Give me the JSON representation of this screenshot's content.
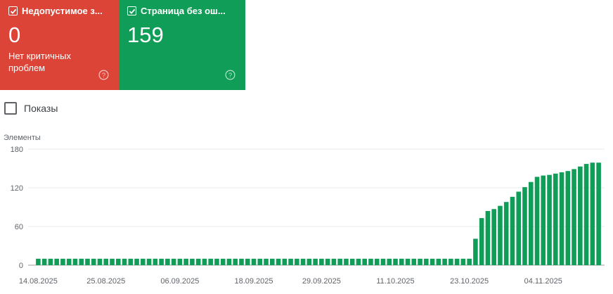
{
  "cards": [
    {
      "title": "Недопустимое з...",
      "value": "0",
      "description": "Нет критичных проблем",
      "color": "#db4437",
      "checked": true
    },
    {
      "title": "Страница без ош...",
      "value": "159",
      "description": "",
      "color": "#0f9d58",
      "checked": true
    }
  ],
  "impressions": {
    "label": "Показы",
    "checked": false
  },
  "chart_data": {
    "type": "bar",
    "ylabel": "Элементы",
    "ylim": [
      0,
      180
    ],
    "yticks": [
      0,
      60,
      120,
      180
    ],
    "x_tick_labels": [
      "14.08.2025",
      "25.08.2025",
      "06.09.2025",
      "18.09.2025",
      "29.09.2025",
      "11.10.2025",
      "23.10.2025",
      "04.11.2025"
    ],
    "bar_color": "#0f9d58",
    "grid": true,
    "start_date": "14.08.2025",
    "series": [
      {
        "values": [
          10,
          10,
          10,
          10,
          10,
          10,
          10,
          10,
          10,
          10,
          10,
          10,
          10,
          10,
          10,
          10,
          10,
          10,
          10,
          10,
          10,
          10,
          10,
          10,
          10,
          10,
          10,
          10,
          10,
          10,
          10,
          10,
          10,
          10,
          10,
          10,
          10,
          10,
          10,
          10,
          10,
          10,
          10,
          10,
          10,
          10,
          10,
          10,
          10,
          10,
          10,
          10,
          10,
          10,
          10,
          10,
          10,
          10,
          10,
          10,
          10,
          10,
          10,
          10,
          10,
          10,
          10,
          10,
          10,
          10,
          10,
          41,
          73,
          84,
          87,
          92,
          98,
          106,
          114,
          121,
          129,
          137,
          139,
          140,
          142,
          144,
          146,
          149,
          153,
          157,
          159,
          159
        ]
      }
    ]
  }
}
